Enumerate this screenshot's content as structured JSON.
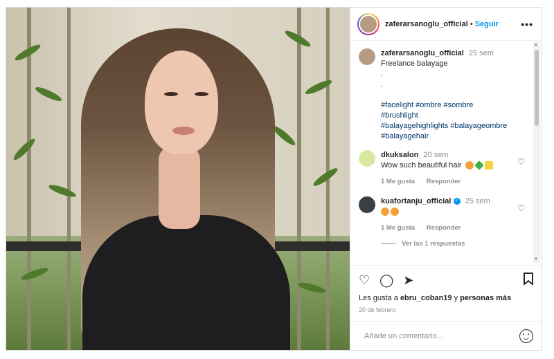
{
  "post": {
    "username": "zaferarsanoglu_official",
    "follow_label": "Seguir",
    "dot": "•"
  },
  "caption": {
    "username": "zaferarsanoglu_official",
    "time": "25 sem",
    "text": "Freelance balayage",
    "dot1": ".",
    "dot2": ".",
    "hashtags": [
      "#facelight",
      "#ombre",
      "#sombre",
      "#brushlight",
      "#balayagehighlights",
      "#balayageombre",
      "#balayagehair"
    ]
  },
  "comments": [
    {
      "username": "dkuksalon",
      "time": "20 sem",
      "text": "Wow such beautiful hair",
      "likes": "1 Me gusta",
      "reply_label": "Responder"
    },
    {
      "username": "kuafortanju_official",
      "time": "25 sem",
      "text": "",
      "likes": "1 Me gusta",
      "reply_label": "Responder",
      "view_replies": "Ver las 1 respuestas"
    }
  ],
  "likes_line": {
    "prefix": "Les gusta a",
    "user": "ebru_coban19",
    "mid": "y",
    "rest": "personas más"
  },
  "date": "20 de febrero",
  "comment_input": {
    "placeholder": "Añade un comentario..."
  },
  "colors": {
    "accent": "#0095f6",
    "hashtag": "#00376b",
    "muted": "#8e8e8e"
  },
  "icons": [
    "more-icon",
    "heart-icon",
    "comment-icon",
    "share-icon",
    "bookmark-icon",
    "smile-icon"
  ]
}
